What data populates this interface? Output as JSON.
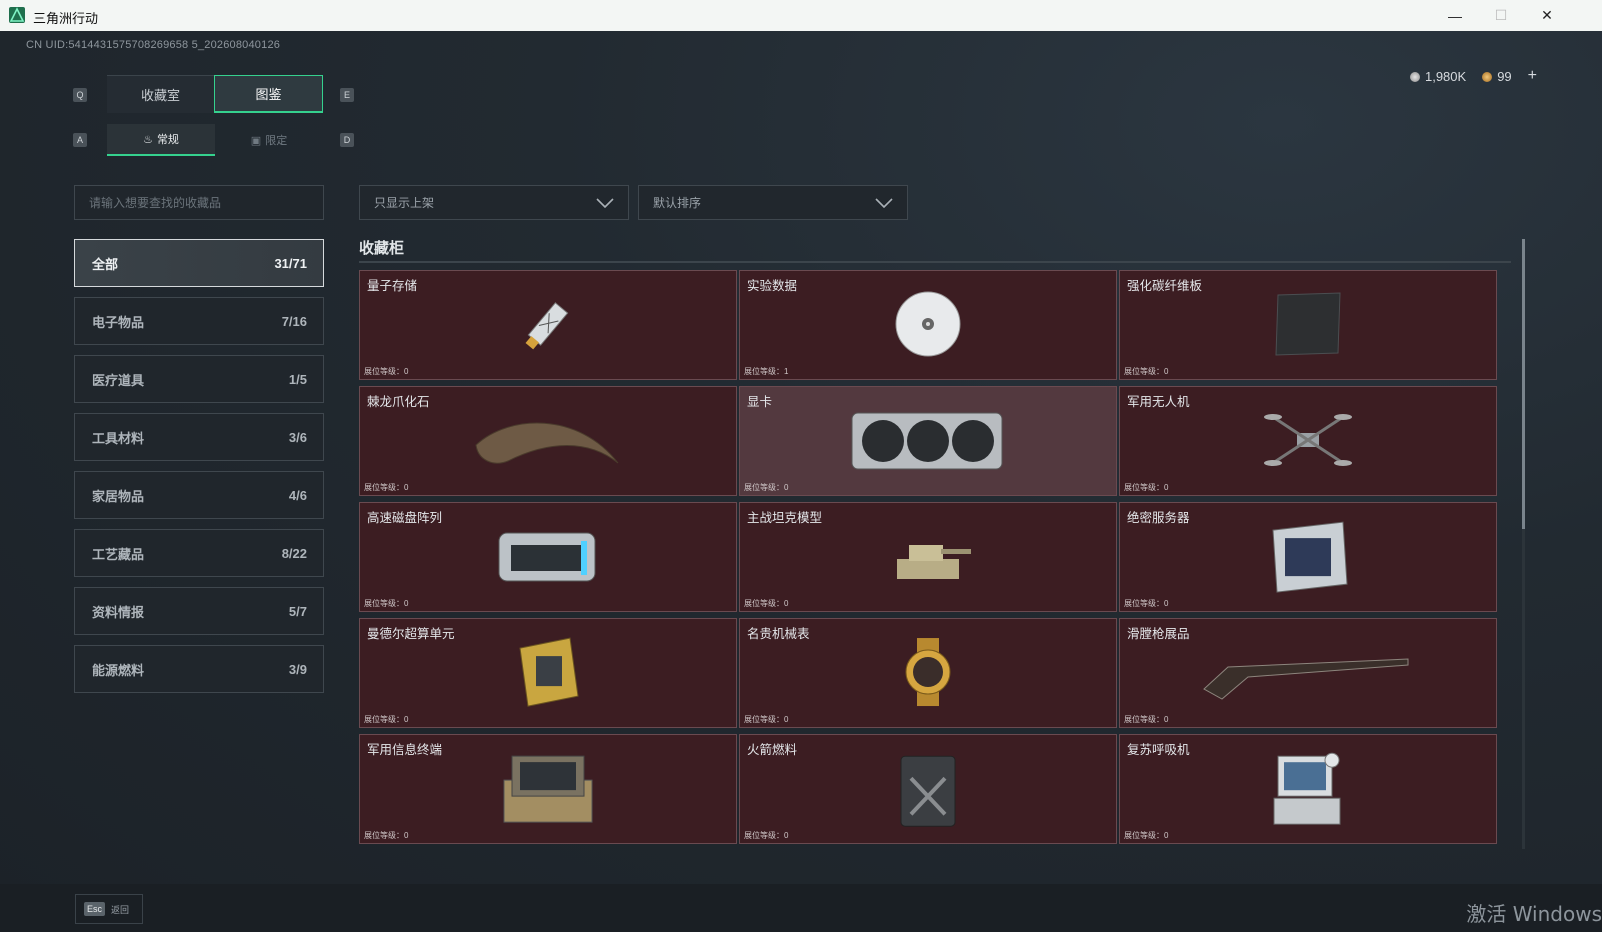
{
  "window": {
    "title": "三角洲行动"
  },
  "uid": "CN UID:5414431575708269658 5_202608040126",
  "currency": {
    "credits": "1,980K",
    "coins": "99",
    "plus": "+"
  },
  "keys": {
    "q": "Q",
    "e": "E",
    "a": "A",
    "d": "D"
  },
  "tabs": [
    "收藏室",
    "图鉴"
  ],
  "subtabs": [
    "常规",
    "限定"
  ],
  "search": {
    "placeholder": "请输入想要查找的收藏品"
  },
  "filters": {
    "show": "只显示上架",
    "sort": "默认排序"
  },
  "categories": [
    {
      "label": "全部",
      "count": "31/71"
    },
    {
      "label": "电子物品",
      "count": "7/16"
    },
    {
      "label": "医疗道具",
      "count": "1/5"
    },
    {
      "label": "工具材料",
      "count": "3/6"
    },
    {
      "label": "家居物品",
      "count": "4/6"
    },
    {
      "label": "工艺藏品",
      "count": "8/22"
    },
    {
      "label": "资料情报",
      "count": "5/7"
    },
    {
      "label": "能源燃料",
      "count": "3/9"
    }
  ],
  "section_title": "收藏柜",
  "items": [
    {
      "name": "量子存储",
      "level": "展位等级：0",
      "icon": "usb-drive-icon"
    },
    {
      "name": "实验数据",
      "level": "展位等级：1",
      "icon": "disc-icon"
    },
    {
      "name": "强化碳纤维板",
      "level": "展位等级：0",
      "icon": "carbon-plate-icon"
    },
    {
      "name": "棘龙爪化石",
      "level": "展位等级：0",
      "icon": "claw-fossil-icon"
    },
    {
      "name": "显卡",
      "level": "展位等级：0",
      "icon": "gpu-icon"
    },
    {
      "name": "军用无人机",
      "level": "展位等级：0",
      "icon": "drone-icon"
    },
    {
      "name": "高速磁盘阵列",
      "level": "展位等级：0",
      "icon": "disk-array-icon"
    },
    {
      "name": "主战坦克模型",
      "level": "展位等级：0",
      "icon": "tank-icon"
    },
    {
      "name": "绝密服务器",
      "level": "展位等级：0",
      "icon": "server-icon"
    },
    {
      "name": "曼德尔超算单元",
      "level": "展位等级：0",
      "icon": "cpu-board-icon"
    },
    {
      "name": "名贵机械表",
      "level": "展位等级：0",
      "icon": "watch-icon"
    },
    {
      "name": "滑膛枪展品",
      "level": "展位等级：0",
      "icon": "musket-icon"
    },
    {
      "name": "军用信息终端",
      "level": "展位等级：0",
      "icon": "terminal-icon"
    },
    {
      "name": "火箭燃料",
      "level": "展位等级：0",
      "icon": "fuel-can-icon"
    },
    {
      "name": "复苏呼吸机",
      "level": "展位等级：0",
      "icon": "ventilator-icon"
    }
  ],
  "footer": {
    "esc_key": "Esc",
    "back": "返回"
  },
  "watermark": "激活 Windows"
}
